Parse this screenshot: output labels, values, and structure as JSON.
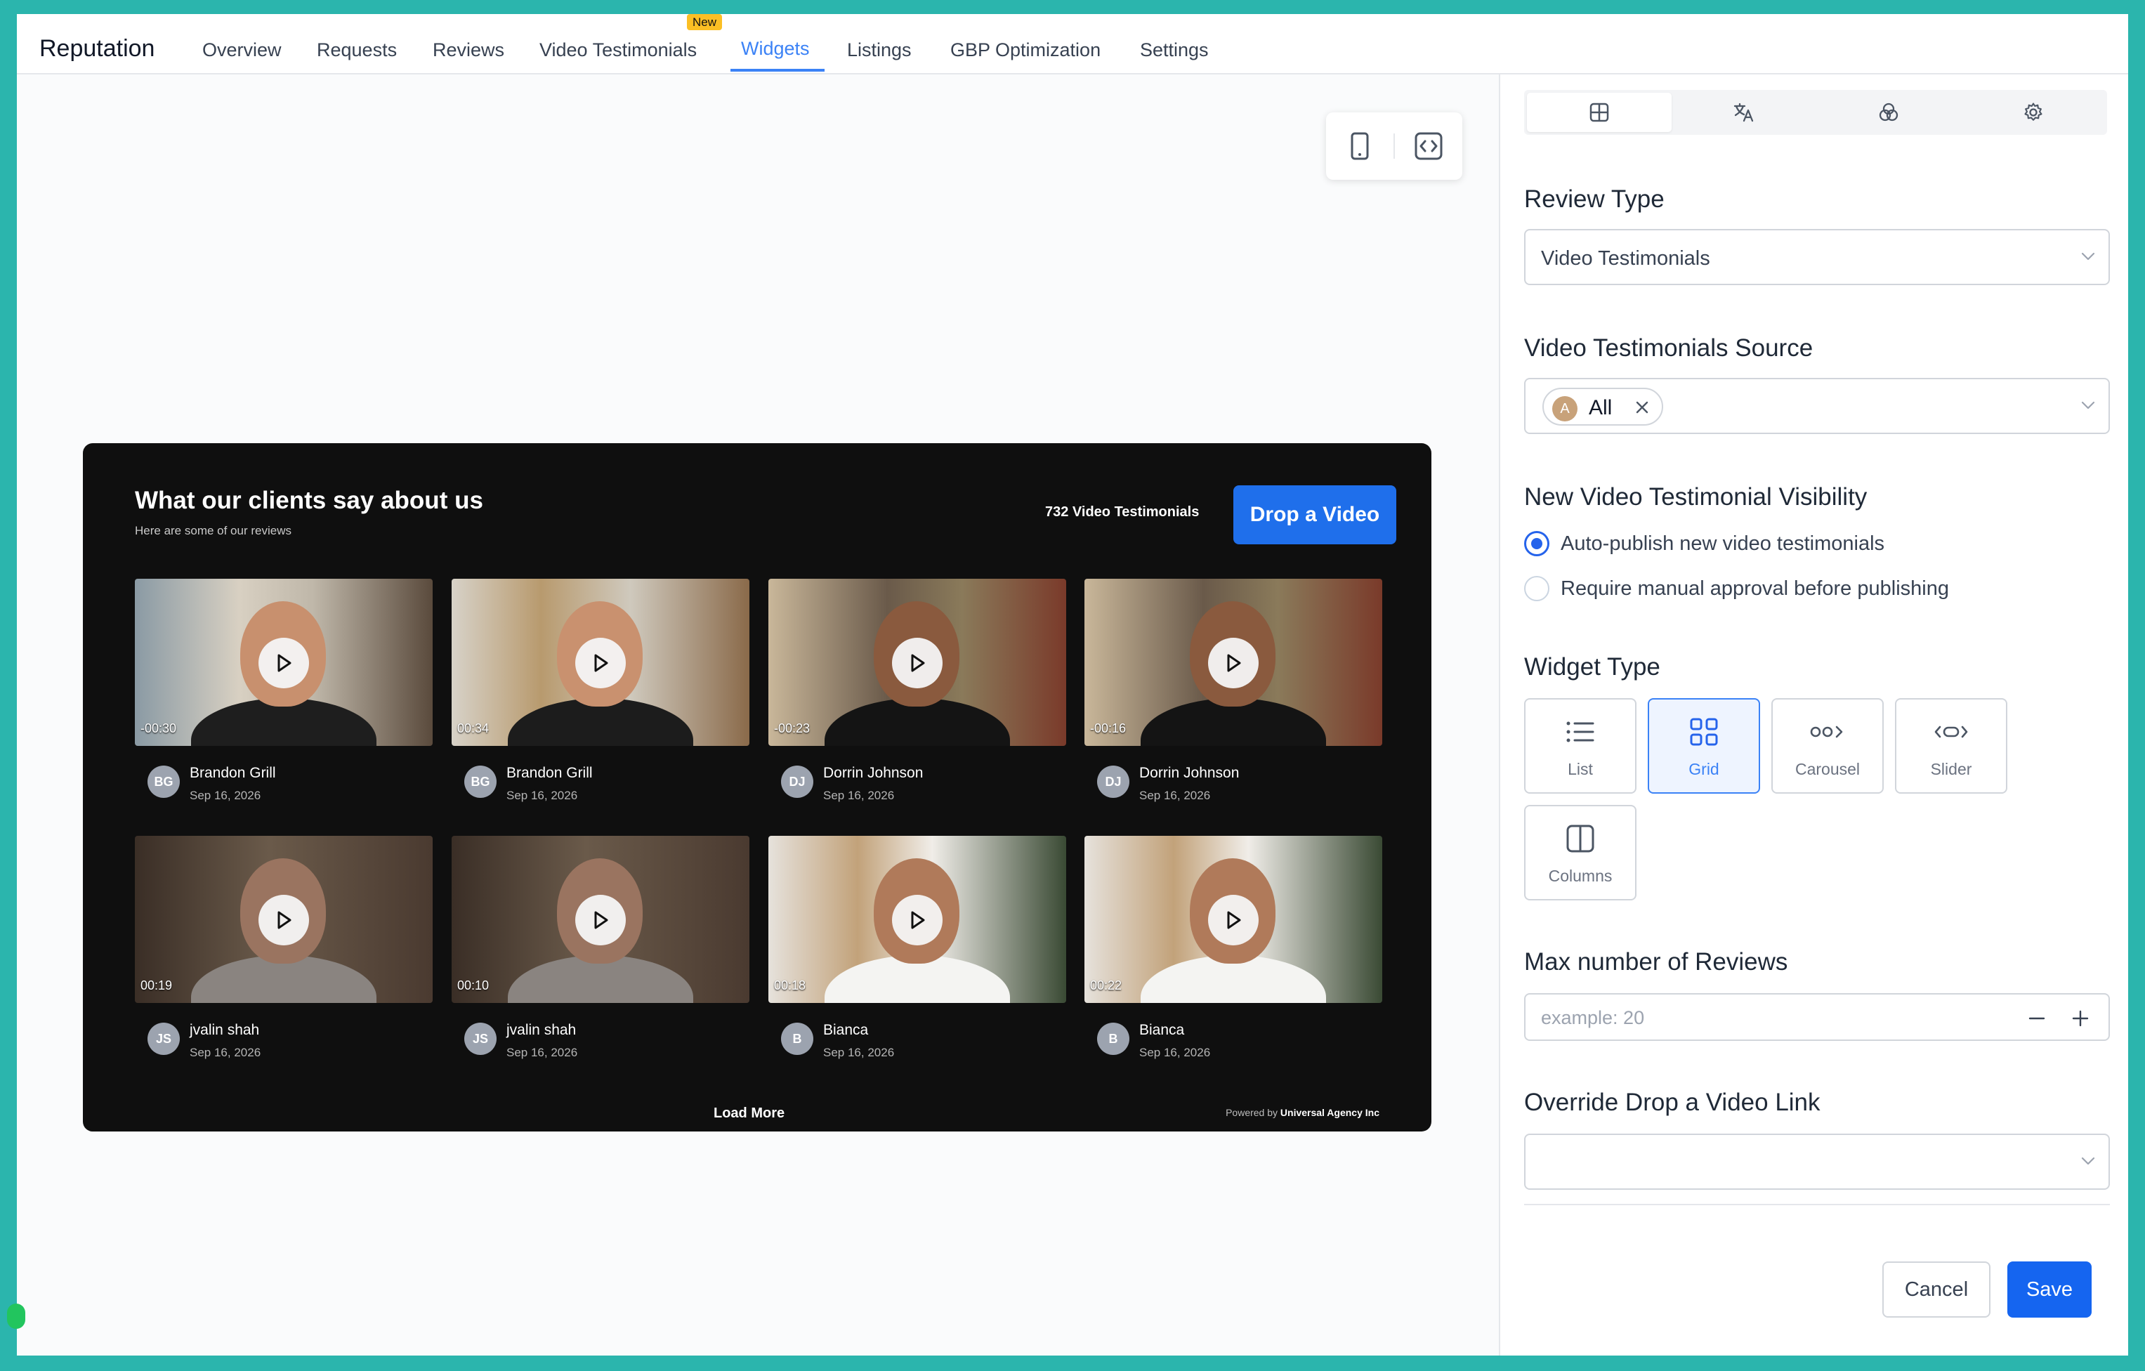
{
  "app": {
    "brand": "Reputation",
    "nav": [
      {
        "label": "Overview"
      },
      {
        "label": "Requests"
      },
      {
        "label": "Reviews"
      },
      {
        "label": "Video Testimonials",
        "badge": "New"
      },
      {
        "label": "Widgets",
        "active": true
      },
      {
        "label": "Listings"
      },
      {
        "label": "GBP Optimization"
      },
      {
        "label": "Settings"
      }
    ]
  },
  "preview": {
    "device_icons": [
      "mobile-icon",
      "code-icon"
    ]
  },
  "widget": {
    "title": "What our clients say about us",
    "subtitle": "Here are some of our reviews",
    "count_text": "732 Video Testimonials",
    "drop_button": "Drop a Video",
    "cards": [
      {
        "duration": "-00:30",
        "initials": "BG",
        "name": "Brandon Grill",
        "date": "Sep 16, 2026"
      },
      {
        "duration": "00:34",
        "initials": "BG",
        "name": "Brandon Grill",
        "date": "Sep 16, 2026"
      },
      {
        "duration": "-00:23",
        "initials": "DJ",
        "name": "Dorrin Johnson",
        "date": "Sep 16, 2026"
      },
      {
        "duration": "-00:16",
        "initials": "DJ",
        "name": "Dorrin Johnson",
        "date": "Sep 16, 2026"
      },
      {
        "duration": "00:19",
        "initials": "JS",
        "name": "jvalin shah",
        "date": "Sep 16, 2026"
      },
      {
        "duration": "00:10",
        "initials": "JS",
        "name": "jvalin shah",
        "date": "Sep 16, 2026"
      },
      {
        "duration": "00:18",
        "initials": "B",
        "name": "Bianca",
        "date": "Sep 16, 2026"
      },
      {
        "duration": "00:22",
        "initials": "B",
        "name": "Bianca",
        "date": "Sep 16, 2026"
      }
    ],
    "load_more": "Load More",
    "powered_prefix": "Powered by",
    "powered_brand": "Universal Agency Inc"
  },
  "panel": {
    "tabs": [
      "layout-icon",
      "translate-icon",
      "palette-icon",
      "gear-icon"
    ],
    "review_type": {
      "label": "Review Type",
      "value": "Video Testimonials"
    },
    "source": {
      "label": "Video Testimonials Source",
      "chip_initial": "A",
      "chip_text": "All"
    },
    "visibility": {
      "label": "New Video Testimonial Visibility",
      "options": [
        {
          "label": "Auto-publish new video testimonials",
          "selected": true
        },
        {
          "label": "Require manual approval before publishing",
          "selected": false
        }
      ]
    },
    "widget_type": {
      "label": "Widget Type",
      "options": [
        {
          "label": "List",
          "icon": "list-icon"
        },
        {
          "label": "Grid",
          "icon": "grid-icon",
          "selected": true
        },
        {
          "label": "Carousel",
          "icon": "carousel-icon"
        },
        {
          "label": "Slider",
          "icon": "slider-icon"
        },
        {
          "label": "Columns",
          "icon": "columns-icon"
        }
      ]
    },
    "max_reviews": {
      "label": "Max number of Reviews",
      "placeholder": "example: 20"
    },
    "override_link": {
      "label": "Override Drop a Video Link",
      "value": ""
    },
    "cancel": "Cancel",
    "save": "Save"
  },
  "colors": {
    "accent": "#1565f0",
    "frame": "#2bb5ad",
    "widget_bg": "#0f0f0f"
  }
}
